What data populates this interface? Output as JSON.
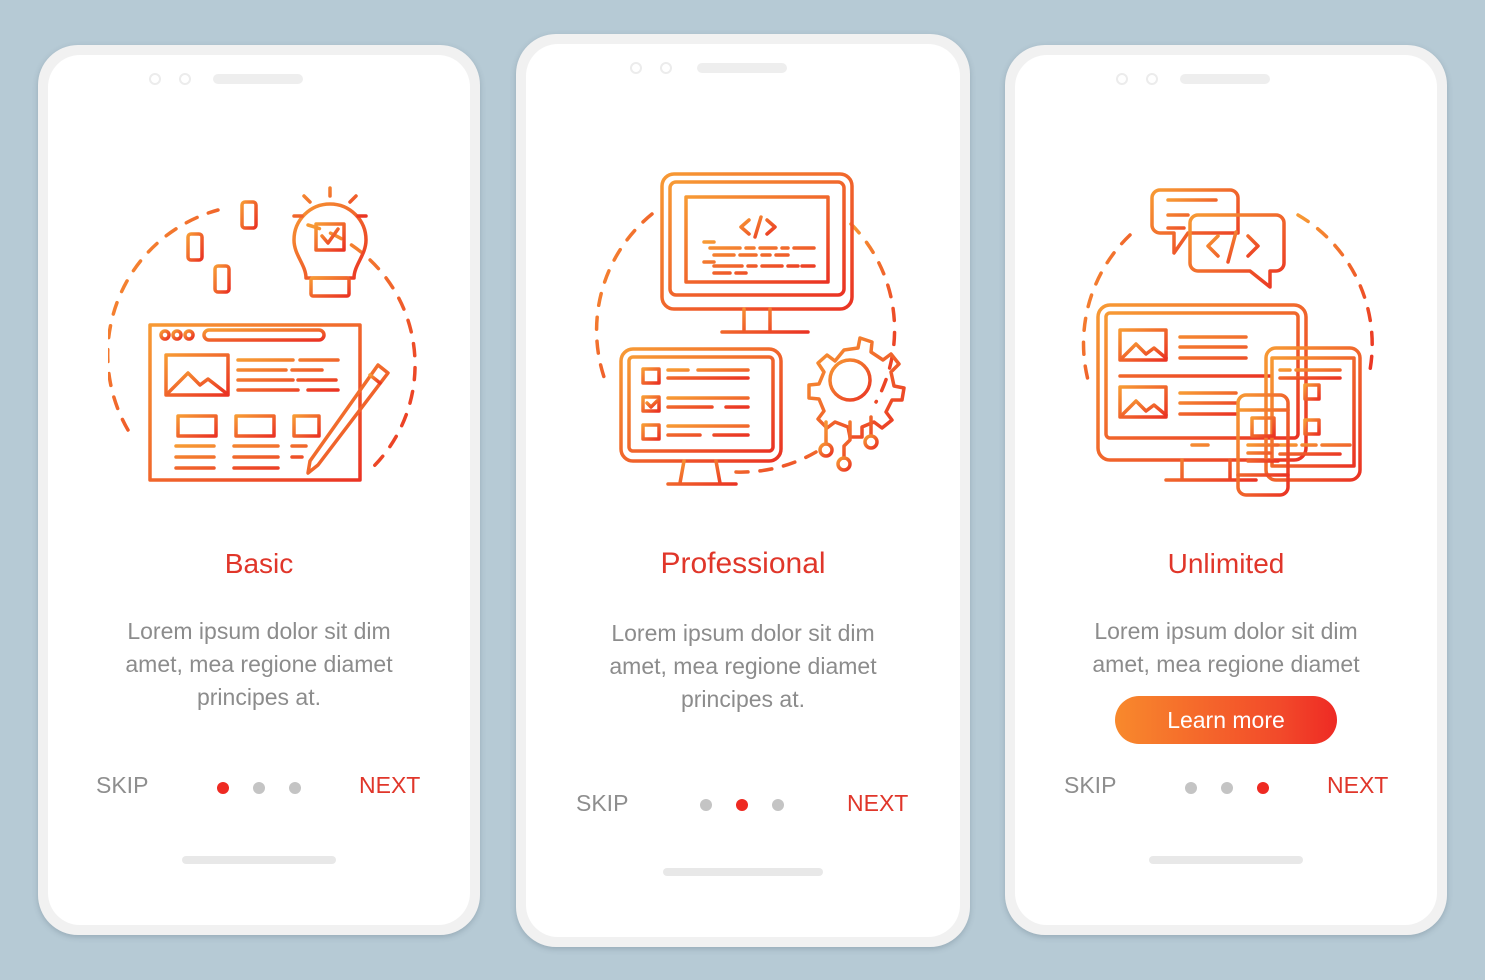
{
  "theme": {
    "background": "#b6cad5",
    "accent": "#e0362a",
    "gradient_start": "#f8892c",
    "gradient_end": "#ee2a24",
    "muted_text": "#8c8c8c",
    "inactive_dot": "#c4c4c4"
  },
  "screens": [
    {
      "title": "Basic",
      "description_lines": [
        "Lorem ipsum dolor sit dim",
        "amet, mea regione diamet",
        "principes at."
      ],
      "illustration": "web-design-icon",
      "skip_label": "SKIP",
      "next_label": "NEXT",
      "page_indicator": {
        "current": 1,
        "total": 3
      }
    },
    {
      "title": "Professional",
      "description_lines": [
        "Lorem ipsum dolor sit dim",
        "amet, mea regione diamet",
        "principes at."
      ],
      "illustration": "software-development-icon",
      "skip_label": "SKIP",
      "next_label": "NEXT",
      "page_indicator": {
        "current": 2,
        "total": 3
      }
    },
    {
      "title": "Unlimited",
      "description_lines": [
        "Lorem ipsum dolor sit dim",
        "amet, mea regione diamet"
      ],
      "illustration": "responsive-web-icon",
      "button_label": "Learn more",
      "skip_label": "SKIP",
      "next_label": "NEXT",
      "page_indicator": {
        "current": 3,
        "total": 3
      }
    }
  ]
}
